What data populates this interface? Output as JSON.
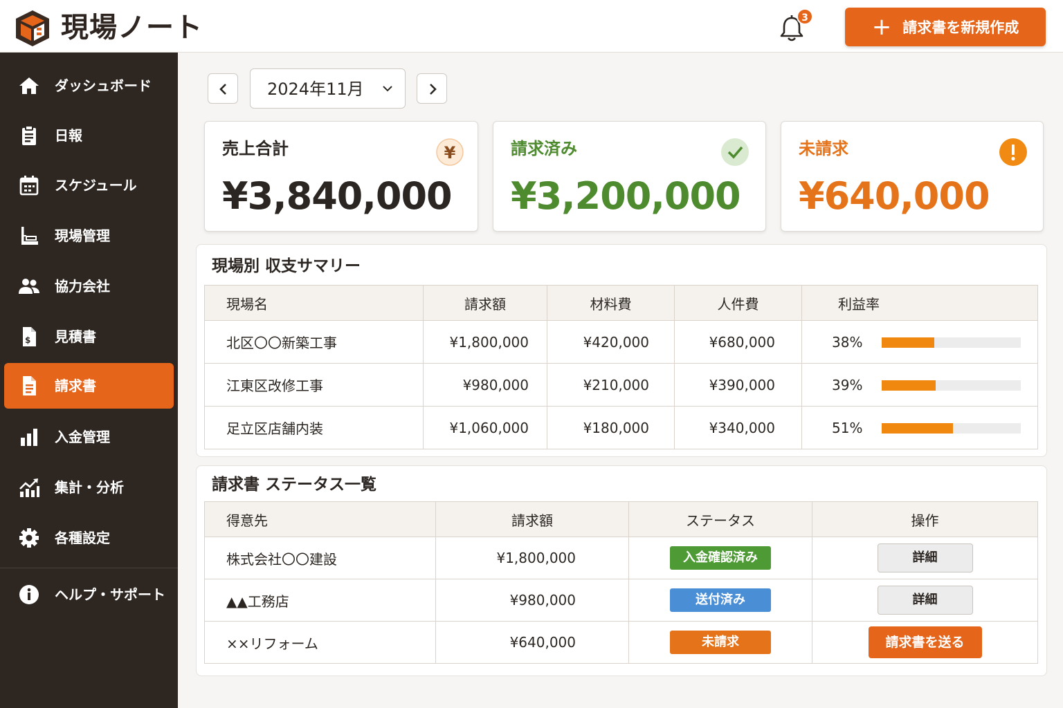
{
  "app": {
    "title": "現場ノート"
  },
  "header": {
    "notification_count": "3",
    "new_invoice_label": "請求書を新規作成"
  },
  "sidebar": {
    "items": [
      {
        "label": "ダッシュボード",
        "icon": "home-icon"
      },
      {
        "label": "日報",
        "icon": "clipboard-icon"
      },
      {
        "label": "スケジュール",
        "icon": "calendar-icon"
      },
      {
        "label": "現場管理",
        "icon": "crane-icon"
      },
      {
        "label": "協力会社",
        "icon": "people-icon"
      },
      {
        "label": "見積書",
        "icon": "estimate-document-icon"
      },
      {
        "label": "請求書",
        "icon": "invoice-document-icon",
        "active": true
      },
      {
        "label": "入金管理",
        "icon": "bar-chart-icon"
      },
      {
        "label": "集計・分析",
        "icon": "analytics-icon"
      },
      {
        "label": "各種設定",
        "icon": "gear-icon"
      }
    ],
    "help": {
      "label": "ヘルプ・サポート",
      "icon": "info-icon"
    }
  },
  "month_selector": {
    "value": "2024年11月"
  },
  "summary_cards": [
    {
      "label": "売上合計",
      "value": "¥3,840,000",
      "icon": "yen-icon",
      "color": "#2b2622"
    },
    {
      "label": "請求済み",
      "value": "¥3,200,000",
      "icon": "check-icon",
      "color": "#4e8a2e"
    },
    {
      "label": "未請求",
      "value": "¥640,000",
      "icon": "warning-icon",
      "color": "#e5731a"
    }
  ],
  "site_summary": {
    "title": "現場別 収支サマリー",
    "columns": [
      "現場名",
      "請求額",
      "材料費",
      "人件費",
      "利益率"
    ],
    "rows": [
      {
        "site": "北区〇〇新築工事",
        "billed": "¥1,800,000",
        "materials": "¥420,000",
        "labor": "¥680,000",
        "margin_label": "38%",
        "margin": 38
      },
      {
        "site": "江東区改修工事",
        "billed": "¥980,000",
        "materials": "¥210,000",
        "labor": "¥390,000",
        "margin_label": "39%",
        "margin": 39
      },
      {
        "site": "足立区店舗内装",
        "billed": "¥1,060,000",
        "materials": "¥180,000",
        "labor": "¥340,000",
        "margin_label": "51%",
        "margin": 51
      }
    ]
  },
  "invoice_status": {
    "title": "請求書 ステータス一覧",
    "columns": [
      "得意先",
      "請求額",
      "ステータス",
      "操作"
    ],
    "rows": [
      {
        "client": "株式会社〇〇建設",
        "amount": "¥1,800,000",
        "status": "入金確認済み",
        "status_color": "#4e9a35",
        "action": "詳細"
      },
      {
        "client": "▲▲工務店",
        "amount": "¥980,000",
        "status": "送付済み",
        "status_color": "#4a8fd6",
        "action": "詳細"
      },
      {
        "client": "××リフォーム",
        "amount": "¥640,000",
        "status": "未請求",
        "status_color": "#e5731a",
        "action": "請求書を送る"
      }
    ]
  },
  "colors": {
    "accent": "#e5651a",
    "sidebar": "#2e2621"
  }
}
